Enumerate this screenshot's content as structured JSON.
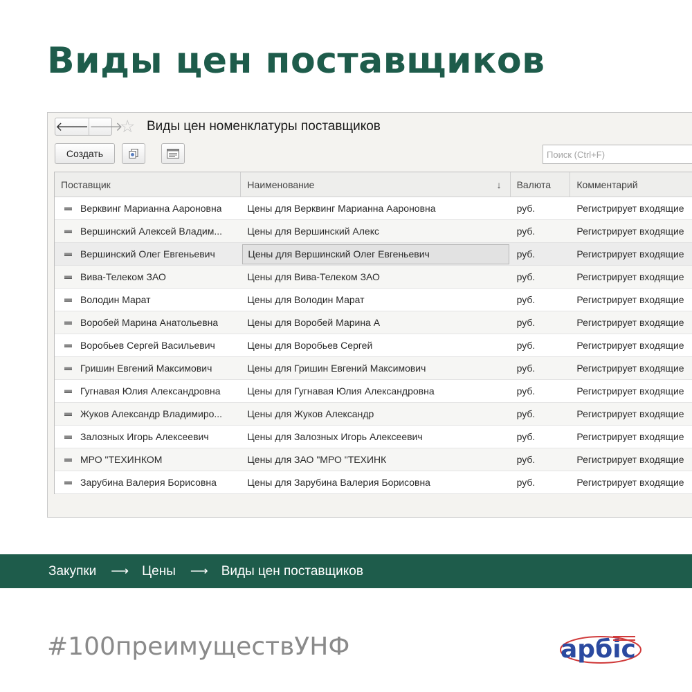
{
  "heading": "Виды цен поставщиков",
  "window": {
    "title": "Виды цен номенклатуры поставщиков",
    "nav": {
      "back_icon": "arrow-left-icon",
      "forward_icon": "arrow-right-icon",
      "back_glyph": "🡐",
      "forward_glyph": "🡒"
    },
    "favorite_icon": "star-icon",
    "toolbar": {
      "create_label": "Создать",
      "copy_icon": "copy-icon",
      "list_settings_icon": "list-settings-icon"
    },
    "search": {
      "placeholder": "Поиск (Ctrl+F)"
    }
  },
  "table": {
    "columns": [
      {
        "label": "Поставщик"
      },
      {
        "label": "Наименование",
        "sort_icon": "arrow-down-icon",
        "sort_glyph": "↓"
      },
      {
        "label": "Валюта"
      },
      {
        "label": "Комментарий"
      }
    ],
    "current_row": 2,
    "rows": [
      {
        "supplier": "Верквинг Марианна Аароновна",
        "name": "Цены для Верквинг Марианна Аароновна",
        "currency": "руб.",
        "comment": "Регистрирует входящие"
      },
      {
        "supplier": "Вершинский Алексей Владим...",
        "name": "Цены для Вершинский Алекс",
        "currency": "руб.",
        "comment": "Регистрирует входящие"
      },
      {
        "supplier": "Вершинский Олег Евгеньевич",
        "name": "Цены для Вершинский Олег Евгеньевич",
        "currency": "руб.",
        "comment": "Регистрирует входящие"
      },
      {
        "supplier": "Вива-Телеком ЗАО",
        "name": "Цены для Вива-Телеком ЗАО",
        "currency": "руб.",
        "comment": "Регистрирует входящие"
      },
      {
        "supplier": "Володин Марат",
        "name": "Цены для Володин Марат",
        "currency": "руб.",
        "comment": "Регистрирует входящие"
      },
      {
        "supplier": "Воробей Марина Анатольевна",
        "name": "Цены для Воробей Марина А",
        "currency": "руб.",
        "comment": "Регистрирует входящие"
      },
      {
        "supplier": "Воробьев Сергей Васильевич",
        "name": "Цены для Воробьев Сергей",
        "currency": "руб.",
        "comment": "Регистрирует входящие"
      },
      {
        "supplier": "Гришин Евгений Максимович",
        "name": "Цены для Гришин Евгений Максимович",
        "currency": "руб.",
        "comment": "Регистрирует входящие"
      },
      {
        "supplier": "Гугнавая Юлия Александровна",
        "name": "Цены для Гугнавая Юлия Александровна",
        "currency": "руб.",
        "comment": "Регистрирует входящие"
      },
      {
        "supplier": "Жуков Александр Владимиро...",
        "name": "Цены для Жуков Александр",
        "currency": "руб.",
        "comment": "Регистрирует входящие"
      },
      {
        "supplier": "Залозных Игорь Алексеевич",
        "name": "Цены для Залозных Игорь Алексеевич",
        "currency": "руб.",
        "comment": "Регистрирует входящие"
      },
      {
        "supplier": "МРО \"ТЕХИНКОМ",
        "name": "Цены для ЗАО \"МРО \"ТЕХИНК",
        "currency": "руб.",
        "comment": "Регистрирует входящие"
      },
      {
        "supplier": "Зарубина Валерия Борисовна",
        "name": "Цены для Зарубина Валерия Борисовна",
        "currency": "руб.",
        "comment": "Регистрирует входящие"
      }
    ]
  },
  "breadcrumb": {
    "items": [
      "Закупки",
      "Цены",
      "Виды цен поставщиков"
    ],
    "separator": "⟶"
  },
  "hashtag": "#100преимуществУНФ",
  "logo": {
    "icon": "arbis-logo-icon",
    "text": "арбіс",
    "color": "#2b4aa0",
    "accent": "#d03a3a"
  },
  "colors": {
    "brand_green": "#1e5c4b"
  }
}
